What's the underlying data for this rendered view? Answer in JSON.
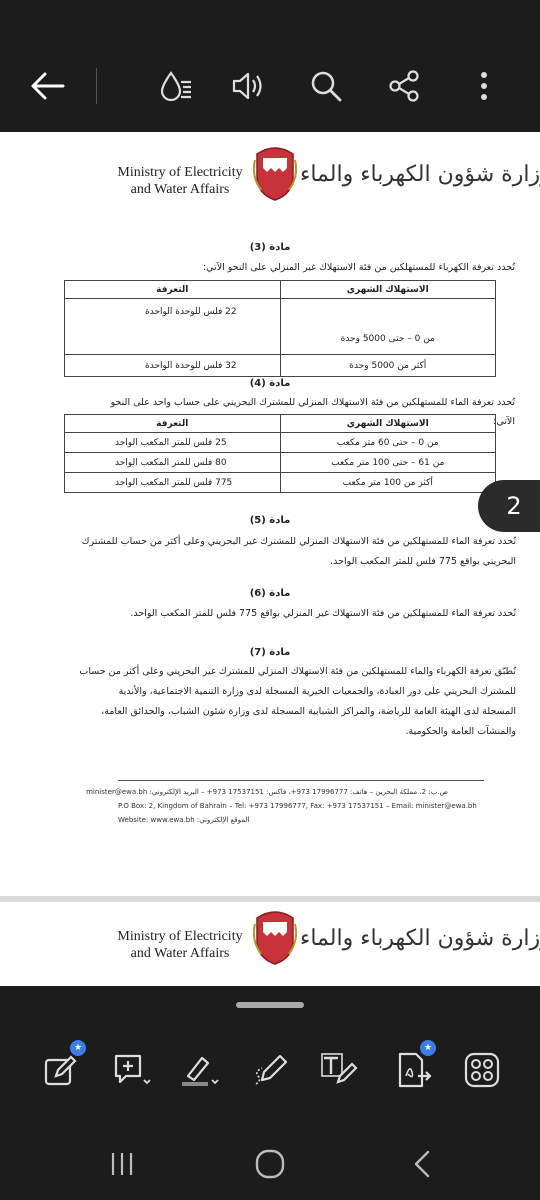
{
  "doc": {
    "ministry_en": "Ministry of Electricity and Water Affairs",
    "ministry_ar": "وزارة شؤون الكهرباء والماء",
    "articles": [
      {
        "title": "مادة (3)",
        "intro": "تُحدد تعرفة الكهرباء للمستهلكين من فئة الاستهلاك غير المنزلي على النحو الآتي:",
        "headers": [
          "الاستهلاك الشهري",
          "التعرفة"
        ],
        "rows": [
          [
            "من 0 – حتى 5000 وحدة",
            "22 فلس للوحدة الواحدة"
          ],
          [
            "أكثر من 5000 وحدة",
            "32 فلس للوحدة الواحدة"
          ]
        ]
      },
      {
        "title": "مادة (4)",
        "intro": "تُحدد تعرفة الماء للمستهلكين من فئة الاستهلاك المنزلي للمشترك البحريني على حساب واحد على النحو الآتي:",
        "headers": [
          "الاستهلاك الشهري",
          "التعرفة"
        ],
        "rows": [
          [
            "من 0 – حتى 60 متر مكعب",
            "25 فلس للمتر المكعب الواحد"
          ],
          [
            "من 61 – حتى 100 متر مكعب",
            "80 فلس للمتر المكعب الواحد"
          ],
          [
            "أكثر من 100 متر مكعب",
            "775 فلس للمتر المكعب الواحد"
          ]
        ]
      },
      {
        "title": "مادة (5)",
        "lines": [
          "تُحدد تعرفة الماء للمستهلكين من فئة الاستهلاك المنزلي للمشترك غير البحريني وعلى أكثر من حساب للمشترك",
          "البحريني بواقع 775 فلس للمتر المكعب الواحد."
        ]
      },
      {
        "title": "مادة (6)",
        "lines": [
          "تُحدد تعرفة الماء للمستهلكين من فئة الاستهلاك غير المنزلي بواقع 775 فلس للمتر المكعب الواحد."
        ]
      },
      {
        "title": "مادة (7)",
        "lines": [
          "تُطبّق تعرفة الكهرباء والماء للمستهلكين من فئة الاستهلاك المنزلي للمشترك غير البحريني وعلى أكثر من حساب",
          "للمشترك البحريني على دور العبادة، والجمعيات الخيرية المسجلة لدى وزارة التنمية الاجتماعية، والأندية",
          "المسجلة لدى الهيئة العامة للرياضة، والمراكز الشبابية المسجلة لدى وزارة شئون الشباب، والحدائق العامة،",
          "والمنشآت العامة والحكومية."
        ]
      }
    ],
    "footer": [
      "ص.ب: 2، مملكة البحرين – هاتف: 17996777 973+، فاكس: 17537151 973+ – البريد الإلكتروني: minister@ewa.bh",
      "P.O Box: 2, Kingdom of Bahrain – Tel: +973 17996777, Fax: +973 17537151 – Email: minister@ewa.bh",
      "Website: www.ewa.bh :الموقع الإلكتروني"
    ],
    "page_number": "2"
  },
  "toolbar_icons": [
    "back-arrow-icon",
    "reading-mode-icon",
    "read-aloud-icon",
    "search-icon",
    "share-icon",
    "more-options-icon"
  ],
  "bottom_icons": [
    "edit-icon",
    "add-comment-icon",
    "highlight-icon",
    "draw-icon",
    "text-edit-icon",
    "export-pdf-icon",
    "apps-grid-icon"
  ],
  "nav_icons": [
    "recent-apps-icon",
    "home-icon",
    "back-icon"
  ],
  "colors": {
    "bar": "#1c1c1c",
    "badge_star": "#3c7de8",
    "page": "#ffffff"
  }
}
